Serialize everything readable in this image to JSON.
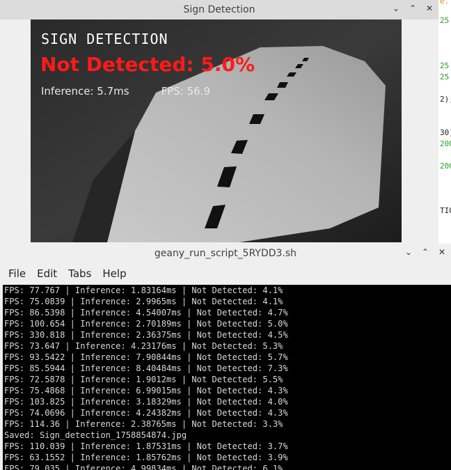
{
  "background_editor": {
    "fragments": [
      {
        "text": "e.",
        "color": "#e08a00"
      },
      {
        "text": "25",
        "color": "#2a9a2a"
      },
      {
        "text": "25",
        "color": "#2a9a2a"
      },
      {
        "text": "25",
        "color": "#2a9a2a"
      },
      {
        "text": "2);",
        "color": "#222222"
      },
      {
        "text": "30)",
        "color": "#222222"
      },
      {
        "text": "200",
        "color": "#2a9a2a"
      },
      {
        "text": "200",
        "color": "#2a9a2a"
      },
      {
        "text": "TIO",
        "color": "#222222"
      }
    ]
  },
  "sign_window": {
    "title": "Sign Detection",
    "overlay": {
      "heading": "SIGN DETECTION",
      "status": "Not Detected: 5.0%",
      "inference": "Inference: 5.7ms",
      "fps": "FPS: 56.9"
    }
  },
  "terminal_window": {
    "title": "geany_run_script_5RYDD3.sh",
    "menu": [
      "File",
      "Edit",
      "Tabs",
      "Help"
    ],
    "lines": [
      "FPS: 77.767 | Inference: 1.83164ms | Not Detected: 4.1%",
      "FPS: 75.0839 | Inference: 2.9965ms | Not Detected: 4.1%",
      "FPS: 86.5398 | Inference: 4.54007ms | Not Detected: 4.7%",
      "FPS: 100.654 | Inference: 2.70189ms | Not Detected: 5.0%",
      "FPS: 330.818 | Inference: 2.36375ms | Not Detected: 4.5%",
      "FPS: 73.647 | Inference: 4.23176ms | Not Detected: 5.3%",
      "FPS: 93.5422 | Inference: 7.90844ms | Not Detected: 5.7%",
      "FPS: 85.5944 | Inference: 8.40484ms | Not Detected: 7.3%",
      "FPS: 72.5878 | Inference: 1.9012ms | Not Detected: 5.5%",
      "FPS: 75.4868 | Inference: 6.99015ms | Not Detected: 4.3%",
      "FPS: 103.825 | Inference: 3.18329ms | Not Detected: 4.0%",
      "FPS: 74.0696 | Inference: 4.24382ms | Not Detected: 4.3%",
      "FPS: 114.36 | Inference: 2.38765ms | Not Detected: 3.3%",
      "Saved: Sign_detection_1758854874.jpg",
      "FPS: 110.039 | Inference: 1.87531ms | Not Detected: 3.7%",
      "FPS: 63.1552 | Inference: 1.85762ms | Not Detected: 3.9%",
      "FPS: 79.035 | Inference: 4.99834ms | Not Detected: 6.1%"
    ]
  },
  "window_controls": {
    "minimize": "⌄",
    "maximize": "⌃",
    "close": "✕"
  }
}
